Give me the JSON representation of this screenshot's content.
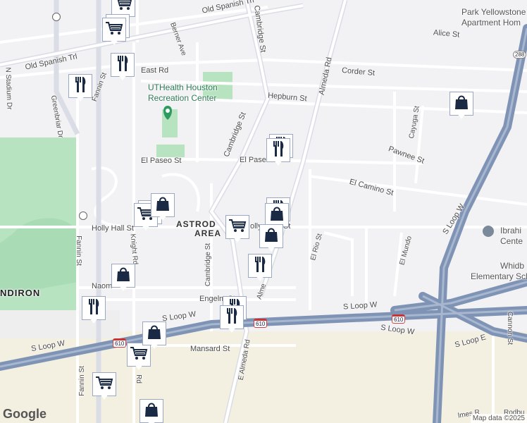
{
  "streets": {
    "old_spanish_trl_top": "Old Spanish Trl",
    "old_spanish_trl_left": "Old Spanish Trl",
    "berner_ave": "Berner Ave",
    "cambridge_st_top": "Cambridge St",
    "cambridge_st_mid": "Cambridge St",
    "cambridge_st_bottom": "Cambridge St",
    "almeda_rd": "Almeda Rd",
    "almeda_rd_lower": "Alme",
    "e_almeda_rd": "E Almeda Rd",
    "alice_st": "Alice St",
    "corder_st": "Corder St",
    "east_rd": "East Rd",
    "hepburn_st": "Hepburn St",
    "n_stadium_dr": "N Stadium Dr",
    "greenbriar_dr": "Greenbriar Dr",
    "fannin_st_top": "Fannin St",
    "fannin_st_mid": "Fannin St",
    "fannin_st_bottom": "Fannin St",
    "cayuga_st": "Cayuga St",
    "pawnee_st": "Pawnee St",
    "el_paseo_st": "El Paseo St",
    "el_paseo_right": "El Pase",
    "el_camino_st": "El Camino St",
    "holly_hall_st": "Holly Hall St",
    "holly_hall_right": "olly",
    "holly_hall_end": "St",
    "el_rio_st": "El Rio St",
    "el_mundo": "El Mundo",
    "s_loop_w_upper": "S Loop W",
    "s_loop_w_left": "S Loop W",
    "s_loop_w_mid": "S Loop W",
    "s_loop_w_bottom_left": "S Loop W",
    "s_loop_w_bottom_right": "S Loop W",
    "s_loop_e": "S Loop E",
    "knight_rd": "Knight Rd",
    "naomi": "Naom",
    "engelmohr": "Engelm   St",
    "mansard_st": "Mansard St",
    "cannon_st": "Cannon St",
    "rd_fragment": "Rd",
    "rodbu": "Rodbu",
    "holmes": "lmes R"
  },
  "places": {
    "recreation_center": "UTHealth Houston\nRecreation Center",
    "park_yellowstone": "Park Yellowstone\nApartment Hom",
    "ibrahim": "Ibrahi\nCente",
    "whidby": "Elementary School",
    "whidby_top": "Whidb",
    "astrodome_area": "ASTRODOME\nAREA",
    "astro_short_1": "ASTROD",
    "astro_short_2": "AREA",
    "ndiron": "NDIRON"
  },
  "shields": {
    "i610_a": "610",
    "i610_b": "610",
    "i610_c": "610",
    "us288": "288"
  },
  "footer": {
    "map_data": "Map data ©2025",
    "google": "Google"
  },
  "icons": {
    "restaurant": "restaurant-icon",
    "shopping_cart": "shopping-cart-icon",
    "shopping_bag": "shopping-bag-icon",
    "park": "park-pin-icon"
  },
  "colors": {
    "background": "#f2f1f4",
    "park_green": "#b7e3c0",
    "highway": "#7f93b5",
    "road": "#ffffff",
    "pin_icon": "#1a2a44"
  }
}
